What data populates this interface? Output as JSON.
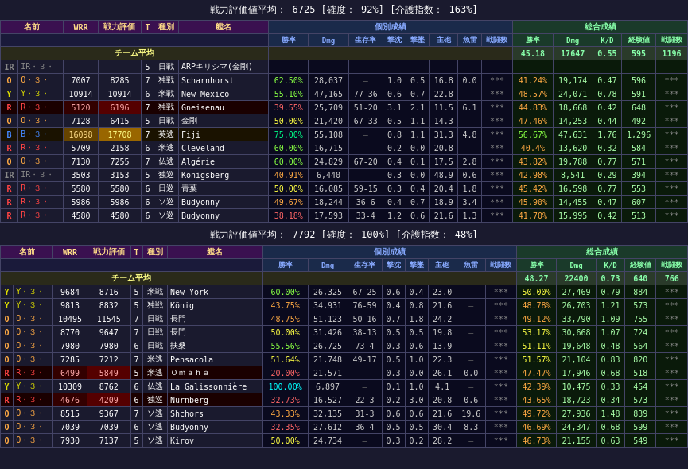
{
  "section1": {
    "header": "戦力評価値平均： 6725 [確度： 92%] [介護指数： 163%]",
    "table": {
      "col_headers": [
        "名前",
        "WRR",
        "戦力評価",
        "T",
        "種別",
        "艦名"
      ],
      "sub_headers_individual": [
        "勝率",
        "Dmg",
        "生存率",
        "撃沈",
        "撃墜",
        "主砲",
        "魚雷",
        "戦闘数"
      ],
      "sub_headers_total": [
        "勝率",
        "Dmg",
        "K/D",
        "経験値",
        "戦闘数"
      ],
      "team_avg": {
        "individual": [
          "",
          "",
          "",
          "",
          "",
          "",
          "",
          ""
        ],
        "total": [
          "45.18",
          "17647",
          "0.55",
          "595",
          "1196"
        ]
      },
      "rows": [
        {
          "rank": "IR",
          "name": "IR・３・",
          "wrr": "",
          "eval": "",
          "t": "5",
          "type": "日戦",
          "ship": "ARPキリシマ(金剛)",
          "wr": "",
          "dmg": "",
          "surv": "",
          "kill": "",
          "aa": "",
          "gun": "",
          "torp": "",
          "battles": "",
          "total_wr": "",
          "total_dmg": "",
          "kd": "",
          "exp": "",
          "total_b": "",
          "highlight": "ir"
        },
        {
          "rank": "O",
          "name": "O・３・",
          "wrr": "7007",
          "eval": "8285",
          "t": "7",
          "type": "独戦",
          "ship": "Scharnhorst",
          "wr": "62.50%",
          "dmg": "28,037",
          "surv": "—",
          "kill": "1.0",
          "aa": "0.5",
          "gun": "16.8",
          "torp": "0.0",
          "battles": "***",
          "total_wr": "41.24%",
          "total_dmg": "19,174",
          "kd": "0.47",
          "exp": "596",
          "total_b": "***",
          "highlight": "normal"
        },
        {
          "rank": "Y",
          "name": "Y・３・",
          "wrr": "10914",
          "eval": "10914",
          "t": "6",
          "type": "米戦",
          "ship": "New Mexico",
          "wr": "55.10%",
          "dmg": "47,165",
          "surv": "77-36",
          "kill": "0.6",
          "aa": "0.7",
          "gun": "22.8",
          "torp": "—",
          "battles": "***",
          "total_wr": "48.57%",
          "total_dmg": "24,071",
          "kd": "0.78",
          "exp": "591",
          "total_b": "***",
          "highlight": "normal"
        },
        {
          "rank": "R",
          "name": "R・３・",
          "wrr": "5120",
          "eval": "6196",
          "t": "7",
          "type": "独戦",
          "ship": "Gneisenau",
          "wr": "39.55%",
          "dmg": "25,709",
          "surv": "51-20",
          "kill": "3.1",
          "aa": "2.1",
          "gun": "11.5",
          "torp": "6.1",
          "battles": "***",
          "total_wr": "44.83%",
          "total_dmg": "18,668",
          "kd": "0.42",
          "exp": "648",
          "total_b": "***",
          "highlight": "r"
        },
        {
          "rank": "O",
          "name": "O・３・",
          "wrr": "7128",
          "eval": "6415",
          "t": "5",
          "type": "日戦",
          "ship": "金剛",
          "wr": "50.00%",
          "dmg": "21,420",
          "surv": "67-33",
          "kill": "0.5",
          "aa": "1.1",
          "gun": "14.3",
          "torp": "—",
          "battles": "***",
          "total_wr": "47.46%",
          "total_dmg": "14,253",
          "kd": "0.44",
          "exp": "492",
          "total_b": "***",
          "highlight": "normal"
        },
        {
          "rank": "B",
          "name": "B・３・",
          "wrr": "16098",
          "eval": "17708",
          "t": "7",
          "type": "英逃",
          "ship": "Fiji",
          "wr": "75.00%",
          "dmg": "55,108",
          "surv": "—",
          "kill": "0.8",
          "aa": "1.1",
          "gun": "31.3",
          "torp": "4.8",
          "battles": "***",
          "total_wr": "56.67%",
          "total_dmg": "47,631",
          "kd": "1.76",
          "exp": "1,296",
          "total_b": "***",
          "highlight": "b"
        },
        {
          "rank": "R",
          "name": "R・３・",
          "wrr": "5709",
          "eval": "2158",
          "t": "6",
          "type": "米逃",
          "ship": "Cleveland",
          "wr": "60.00%",
          "dmg": "16,715",
          "surv": "—",
          "kill": "0.2",
          "aa": "0.0",
          "gun": "20.8",
          "torp": "—",
          "battles": "***",
          "total_wr": "40.4%",
          "total_dmg": "13,620",
          "kd": "0.32",
          "exp": "584",
          "total_b": "***",
          "highlight": "normal"
        },
        {
          "rank": "O",
          "name": "O・３・",
          "wrr": "7130",
          "eval": "7255",
          "t": "7",
          "type": "仏逃",
          "ship": "Algérie",
          "wr": "60.00%",
          "dmg": "24,829",
          "surv": "67-20",
          "kill": "0.4",
          "aa": "0.1",
          "gun": "17.5",
          "torp": "2.8",
          "battles": "***",
          "total_wr": "43.82%",
          "total_dmg": "19,788",
          "kd": "0.77",
          "exp": "571",
          "total_b": "***",
          "highlight": "normal"
        },
        {
          "rank": "IR",
          "name": "IR・３・",
          "wrr": "3503",
          "eval": "3153",
          "t": "5",
          "type": "独巡",
          "ship": "Königsberg",
          "wr": "40.91%",
          "dmg": "6,440",
          "surv": "—",
          "kill": "0.3",
          "aa": "0.0",
          "gun": "48.9",
          "torp": "0.6",
          "battles": "***",
          "total_wr": "42.98%",
          "total_dmg": "8,541",
          "kd": "0.29",
          "exp": "394",
          "total_b": "***",
          "highlight": "ir"
        },
        {
          "rank": "R",
          "name": "R・３・",
          "wrr": "5580",
          "eval": "5580",
          "t": "6",
          "type": "日巡",
          "ship": "青葉",
          "wr": "50.00%",
          "dmg": "16,085",
          "surv": "59-15",
          "kill": "0.3",
          "aa": "0.4",
          "gun": "20.4",
          "torp": "1.8",
          "battles": "***",
          "total_wr": "45.42%",
          "total_dmg": "16,598",
          "kd": "0.77",
          "exp": "553",
          "total_b": "***",
          "highlight": "normal"
        },
        {
          "rank": "R",
          "name": "R・３・",
          "wrr": "5986",
          "eval": "5986",
          "t": "6",
          "type": "ソ巡",
          "ship": "Budyonny",
          "wr": "49.67%",
          "dmg": "18,244",
          "surv": "36-6",
          "kill": "0.4",
          "aa": "0.7",
          "gun": "18.9",
          "torp": "3.4",
          "battles": "***",
          "total_wr": "45.90%",
          "total_dmg": "14,455",
          "kd": "0.47",
          "exp": "607",
          "total_b": "***",
          "highlight": "normal"
        },
        {
          "rank": "R",
          "name": "R・３・",
          "wrr": "4580",
          "eval": "4580",
          "t": "6",
          "type": "ソ巡",
          "ship": "Budyonny",
          "wr": "38.18%",
          "dmg": "17,593",
          "surv": "33-4",
          "kill": "1.2",
          "aa": "0.6",
          "gun": "21.6",
          "torp": "1.3",
          "battles": "***",
          "total_wr": "41.70%",
          "total_dmg": "15,995",
          "kd": "0.42",
          "exp": "513",
          "total_b": "***",
          "highlight": "normal"
        }
      ]
    }
  },
  "section2": {
    "header": "戦力評価値平均： 7792 [確度： 100%] [介護指数： 48%]",
    "table": {
      "team_avg": {
        "total": [
          "48.27",
          "22400",
          "0.73",
          "640",
          "766"
        ]
      },
      "rows": [
        {
          "rank": "Y",
          "name": "Y・３・",
          "wrr": "9684",
          "eval": "8716",
          "t": "5",
          "type": "米戦",
          "ship": "New York",
          "wr": "60.00%",
          "dmg": "26,325",
          "surv": "67-25",
          "kill": "0.6",
          "aa": "0.4",
          "gun": "23.0",
          "torp": "—",
          "battles": "***",
          "total_wr": "50.00%",
          "total_dmg": "27,469",
          "kd": "0.79",
          "exp": "884",
          "total_b": "***",
          "highlight": "normal"
        },
        {
          "rank": "Y",
          "name": "Y・３・",
          "wrr": "9813",
          "eval": "8832",
          "t": "5",
          "type": "独戦",
          "ship": "König",
          "wr": "43.75%",
          "dmg": "34,931",
          "surv": "76-59",
          "kill": "0.4",
          "aa": "0.8",
          "gun": "21.6",
          "torp": "—",
          "battles": "***",
          "total_wr": "48.78%",
          "total_dmg": "26,703",
          "kd": "1.21",
          "exp": "573",
          "total_b": "***",
          "highlight": "normal"
        },
        {
          "rank": "O",
          "name": "O・３・",
          "wrr": "10495",
          "eval": "11545",
          "t": "7",
          "type": "日戦",
          "ship": "長門",
          "wr": "48.75%",
          "dmg": "51,123",
          "surv": "50-16",
          "kill": "0.7",
          "aa": "1.8",
          "gun": "24.2",
          "torp": "—",
          "battles": "***",
          "total_wr": "49.12%",
          "total_dmg": "33,790",
          "kd": "1.09",
          "exp": "755",
          "total_b": "***",
          "highlight": "normal"
        },
        {
          "rank": "O",
          "name": "O・３・",
          "wrr": "8770",
          "eval": "9647",
          "t": "7",
          "type": "日戦",
          "ship": "長門",
          "wr": "50.00%",
          "dmg": "31,426",
          "surv": "38-13",
          "kill": "0.5",
          "aa": "0.5",
          "gun": "19.8",
          "torp": "—",
          "battles": "***",
          "total_wr": "53.17%",
          "total_dmg": "30,668",
          "kd": "1.07",
          "exp": "724",
          "total_b": "***",
          "highlight": "normal"
        },
        {
          "rank": "O",
          "name": "O・３・",
          "wrr": "7980",
          "eval": "7980",
          "t": "6",
          "type": "日戦",
          "ship": "扶桑",
          "wr": "55.56%",
          "dmg": "26,725",
          "surv": "73-4",
          "kill": "0.3",
          "aa": "0.6",
          "gun": "13.9",
          "torp": "—",
          "battles": "***",
          "total_wr": "51.11%",
          "total_dmg": "19,648",
          "kd": "0.48",
          "exp": "564",
          "total_b": "***",
          "highlight": "normal"
        },
        {
          "rank": "O",
          "name": "O・３・",
          "wrr": "7285",
          "eval": "7212",
          "t": "7",
          "type": "米逃",
          "ship": "Pensacola",
          "wr": "51.64%",
          "dmg": "21,748",
          "surv": "49-17",
          "kill": "0.5",
          "aa": "1.0",
          "gun": "22.3",
          "torp": "—",
          "battles": "***",
          "total_wr": "51.57%",
          "total_dmg": "21,104",
          "kd": "0.83",
          "exp": "820",
          "total_b": "***",
          "highlight": "normal"
        },
        {
          "rank": "R",
          "name": "R・３・",
          "wrr": "6499",
          "eval": "5849",
          "t": "5",
          "type": "米逃",
          "ship": "Ｏｍａｈａ",
          "wr": "20.00%",
          "dmg": "21,571",
          "surv": "—",
          "kill": "0.3",
          "aa": "0.0",
          "gun": "26.1",
          "torp": "0.0",
          "battles": "***",
          "total_wr": "47.47%",
          "total_dmg": "17,946",
          "kd": "0.68",
          "exp": "518",
          "total_b": "***",
          "highlight": "r"
        },
        {
          "rank": "Y",
          "name": "Y・３・",
          "wrr": "10309",
          "eval": "8762",
          "t": "6",
          "type": "仏逃",
          "ship": "La Galissonnière",
          "wr": "100.00%",
          "dmg": "6,897",
          "surv": "—",
          "kill": "0.1",
          "aa": "1.0",
          "gun": "4.1",
          "torp": "—",
          "battles": "***",
          "total_wr": "42.39%",
          "total_dmg": "10,475",
          "kd": "0.33",
          "exp": "454",
          "total_b": "***",
          "highlight": "normal"
        },
        {
          "rank": "R",
          "name": "R・３・",
          "wrr": "4676",
          "eval": "4209",
          "t": "6",
          "type": "独巡",
          "ship": "Nürnberg",
          "wr": "32.73%",
          "dmg": "16,527",
          "surv": "22-3",
          "kill": "0.2",
          "aa": "3.0",
          "gun": "20.8",
          "torp": "0.6",
          "battles": "***",
          "total_wr": "43.65%",
          "total_dmg": "18,723",
          "kd": "0.34",
          "exp": "573",
          "total_b": "***",
          "highlight": "r"
        },
        {
          "rank": "O",
          "name": "O・３・",
          "wrr": "8515",
          "eval": "9367",
          "t": "7",
          "type": "ソ逃",
          "ship": "Shchors",
          "wr": "43.33%",
          "dmg": "32,135",
          "surv": "31-3",
          "kill": "0.6",
          "aa": "0.6",
          "gun": "21.6",
          "torp": "19.6",
          "battles": "***",
          "total_wr": "49.72%",
          "total_dmg": "27,936",
          "kd": "1.48",
          "exp": "839",
          "total_b": "***",
          "highlight": "normal"
        },
        {
          "rank": "O",
          "name": "O・３・",
          "wrr": "7039",
          "eval": "7039",
          "t": "6",
          "type": "ソ逃",
          "ship": "Budyonny",
          "wr": "32.35%",
          "dmg": "27,612",
          "surv": "36-4",
          "kill": "0.5",
          "aa": "0.5",
          "gun": "30.4",
          "torp": "8.3",
          "battles": "***",
          "total_wr": "46.69%",
          "total_dmg": "24,347",
          "kd": "0.68",
          "exp": "599",
          "total_b": "***",
          "highlight": "normal"
        },
        {
          "rank": "O",
          "name": "O・３・",
          "wrr": "7930",
          "eval": "7137",
          "t": "5",
          "type": "ソ逃",
          "ship": "Kirov",
          "wr": "50.00%",
          "dmg": "24,734",
          "surv": "—",
          "kill": "0.3",
          "aa": "0.2",
          "gun": "28.2",
          "torp": "—",
          "battles": "***",
          "total_wr": "46.73%",
          "total_dmg": "21,155",
          "kd": "0.63",
          "exp": "549",
          "total_b": "***",
          "highlight": "normal"
        }
      ]
    }
  },
  "ui": {
    "rank_colors": {
      "R": "#ff4444",
      "B": "#4488ff",
      "Y": "#dddd00",
      "O": "#ffaa44",
      "IR": "#aaaaaa"
    }
  }
}
